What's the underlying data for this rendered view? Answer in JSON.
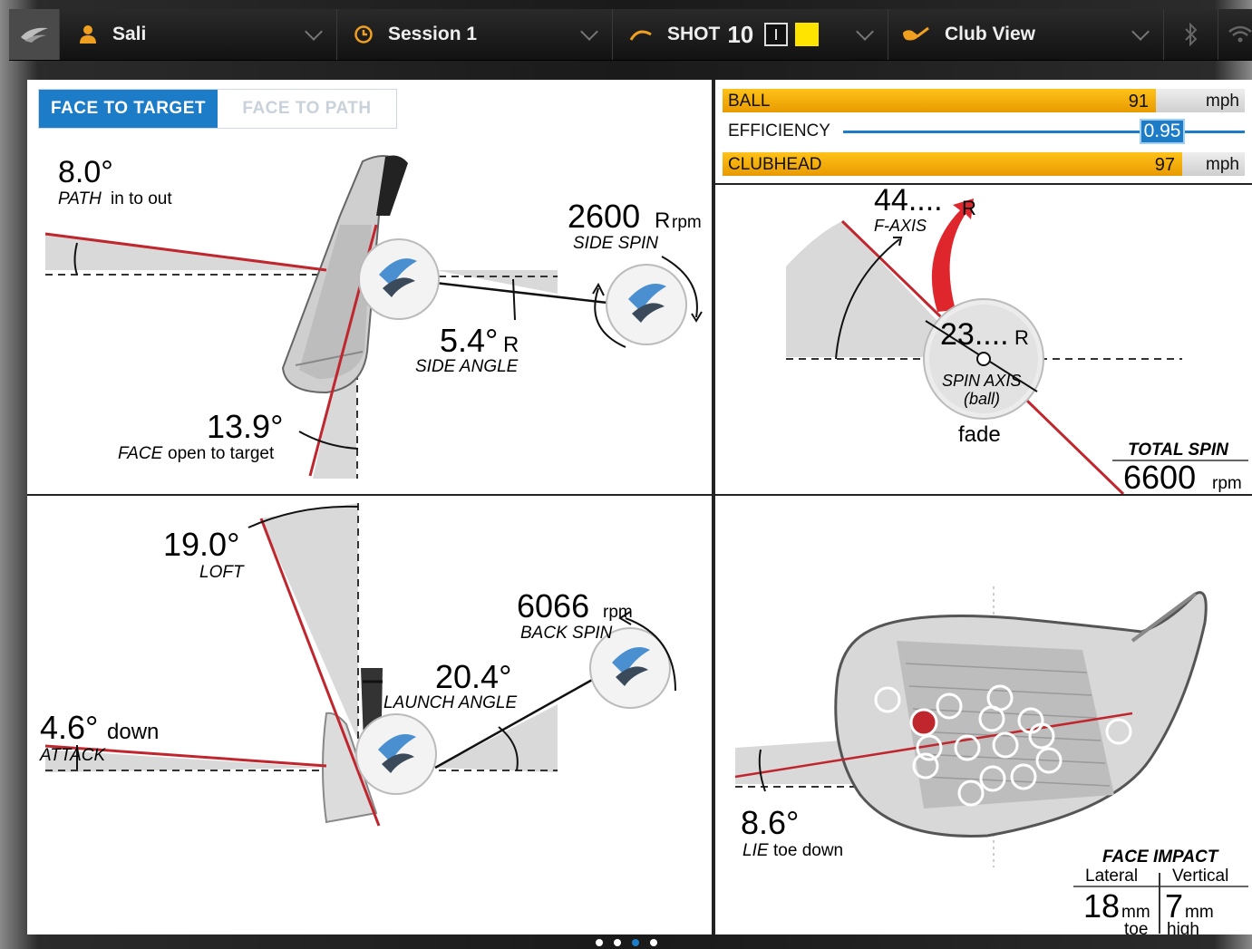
{
  "topbar": {
    "logo_icon": "brand-logo-icon",
    "user": {
      "label": "Sali",
      "icon": "person-icon"
    },
    "session": {
      "label": "Session 1",
      "icon": "clock-icon"
    },
    "shot": {
      "prefix": "SHOT",
      "number": "10",
      "icon": "shot-arc-icon",
      "marker_color": "#ffe400"
    },
    "view": {
      "label": "Club View",
      "icon": "club-icon"
    },
    "bluetooth_icon": "bluetooth-icon",
    "wifi_icon": "wifi-icon"
  },
  "face_panel": {
    "tabs": [
      {
        "label": "FACE TO TARGET",
        "active": true
      },
      {
        "label": "FACE TO PATH",
        "active": false
      }
    ],
    "path": {
      "value": "8.0°",
      "name": "PATH",
      "desc": "in to out"
    },
    "side_spin": {
      "value": "2600",
      "dir": "R",
      "unit": "rpm",
      "label": "SIDE SPIN"
    },
    "side_angle": {
      "value": "5.4°",
      "dir": "R",
      "label": "SIDE ANGLE"
    },
    "face": {
      "value": "13.9°",
      "name": "FACE",
      "desc": "open to target"
    }
  },
  "speed_panel": {
    "ball": {
      "label": "BALL",
      "value": "91",
      "unit": "mph",
      "fill_fraction": 0.83
    },
    "efficiency": {
      "label": "EFFICIENCY",
      "value": "0.95"
    },
    "clubhead": {
      "label": "CLUBHEAD",
      "value": "97",
      "unit": "mph",
      "fill_fraction": 0.88
    }
  },
  "spin_axis_panel": {
    "f_axis": {
      "value": "44....",
      "dir": "R",
      "label": "F-AXIS"
    },
    "spin_axis": {
      "value": "23....",
      "dir": "R",
      "label": "SPIN AXIS",
      "sub": "(ball)"
    },
    "shape": "fade",
    "total_spin": {
      "label": "TOTAL SPIN",
      "value": "6600",
      "unit": "rpm"
    }
  },
  "launch_panel": {
    "loft": {
      "value": "19.0°",
      "label": "LOFT"
    },
    "back_spin": {
      "value": "6066",
      "unit": "rpm",
      "label": "BACK SPIN"
    },
    "launch": {
      "value": "20.4°",
      "label": "LAUNCH ANGLE"
    },
    "attack": {
      "value": "4.6°",
      "dir": "down",
      "label": "ATTACK"
    }
  },
  "impact_panel": {
    "lie": {
      "value": "8.6°",
      "name": "LIE",
      "desc": "toe down"
    },
    "face_impact": {
      "title": "FACE IMPACT",
      "lateral_label": "Lateral",
      "vertical_label": "Vertical",
      "lateral_value": "18",
      "lateral_unit": "mm",
      "lateral_dir": "toe",
      "vertical_value": "7",
      "vertical_unit": "mm",
      "vertical_dir": "high"
    }
  },
  "pager": {
    "count": 4,
    "active": 2
  }
}
